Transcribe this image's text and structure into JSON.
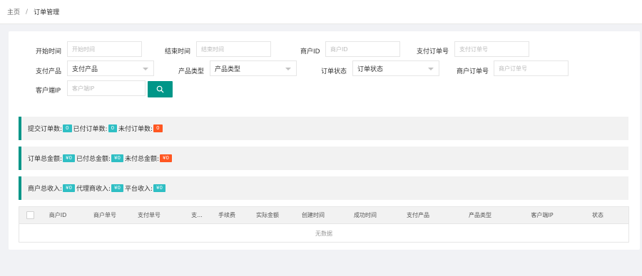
{
  "breadcrumb": {
    "home": "主页",
    "separator": "/",
    "current": "订单管理"
  },
  "filters": {
    "start_time": {
      "label": "开始时间",
      "placeholder": "开始时间"
    },
    "end_time": {
      "label": "结束时间",
      "placeholder": "结束时间"
    },
    "merchant_id": {
      "label": "商户ID",
      "placeholder": "商户ID"
    },
    "pay_order_no": {
      "label": "支付订单号",
      "placeholder": "支付订单号"
    },
    "pay_product": {
      "label": "支付产品",
      "value": "支付产品"
    },
    "product_type": {
      "label": "产品类型",
      "value": "产品类型"
    },
    "order_status": {
      "label": "订单状态",
      "value": "订单状态"
    },
    "merchant_order_no": {
      "label": "商户订单号",
      "placeholder": "商户订单号"
    },
    "client_ip": {
      "label": "客户端IP",
      "placeholder": "客户端IP"
    },
    "search_icon": "search-icon"
  },
  "stats": {
    "orders": {
      "submitted_label": "提交订单数:",
      "submitted_value": "0",
      "paid_label": "已付订单数:",
      "paid_value": "0",
      "unpaid_label": "未付订单数:",
      "unpaid_value": "0"
    },
    "amounts": {
      "total_label": "订单总金额:",
      "total_value": "¥0",
      "paid_label": "已付总金额:",
      "paid_value": "¥0",
      "unpaid_label": "未付总金额:",
      "unpaid_value": "¥0"
    },
    "income": {
      "merchant_label": "商户总收入:",
      "merchant_value": "¥0",
      "agent_label": "代理商收入:",
      "agent_value": "¥0",
      "platform_label": "平台收入:",
      "platform_value": "¥0"
    }
  },
  "table": {
    "columns": [
      "商户ID",
      "商户单号",
      "支付单号",
      "支...",
      "手续费",
      "实际金额",
      "创建时间",
      "成功时间",
      "支付产品",
      "产品类型",
      "客户端IP",
      "状态"
    ],
    "empty_text": "无数据"
  },
  "colors": {
    "accent": "#009688",
    "badge_teal": "#2fbfc4",
    "badge_red": "#ff5722"
  }
}
